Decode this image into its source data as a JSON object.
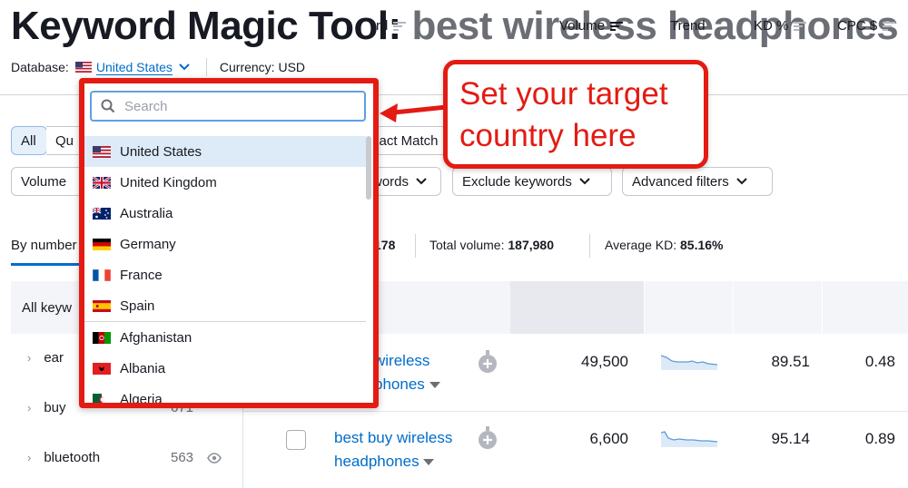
{
  "title": {
    "main": "Keyword Magic Tool:",
    "query": "best wireless headphones"
  },
  "database": {
    "label": "Database:",
    "value": "United States",
    "currency": "Currency: USD"
  },
  "match_tabs": {
    "all": "All",
    "questions_partial": "Qu",
    "exact_partial": "xact Match"
  },
  "filters": {
    "volume": "Volume",
    "include_partial": "words",
    "exclude": "Exclude keywords",
    "advanced": "Advanced filters"
  },
  "tabs": {
    "by_number": "By number"
  },
  "stats": {
    "keywords_partial": "178",
    "total_volume_label": "Total volume:",
    "total_volume": "187,980",
    "avg_kd_label": "Average KD:",
    "avg_kd": "85.16%"
  },
  "sidebar": {
    "header": "All keyw",
    "items": [
      {
        "label": "ear",
        "count": ""
      },
      {
        "label": "buy",
        "count": "671"
      },
      {
        "label": "bluetooth",
        "count": "563"
      }
    ]
  },
  "table": {
    "headers": {
      "keyword_partial": "rd",
      "volume": "Volume",
      "trend": "Trend",
      "kd": "KD %",
      "cpc": "CPC $"
    },
    "rows": [
      {
        "kw_line1": "wireless",
        "kw_line2": "phones",
        "volume": "49,500",
        "kd": "89.51",
        "cpc": "0.48"
      },
      {
        "kw_line1": "best buy wireless",
        "kw_line2": "headphones",
        "volume": "6,600",
        "kd": "95.14",
        "cpc": "0.89"
      }
    ]
  },
  "dropdown": {
    "search_placeholder": "Search",
    "countries": [
      "United States",
      "United Kingdom",
      "Australia",
      "Germany",
      "France",
      "Spain",
      "Afghanistan",
      "Albania",
      "Algeria"
    ]
  },
  "callout": {
    "line1": "Set your target",
    "line2": "country here"
  },
  "colors": {
    "accent": "#006dca",
    "annotation": "#e31b13"
  }
}
